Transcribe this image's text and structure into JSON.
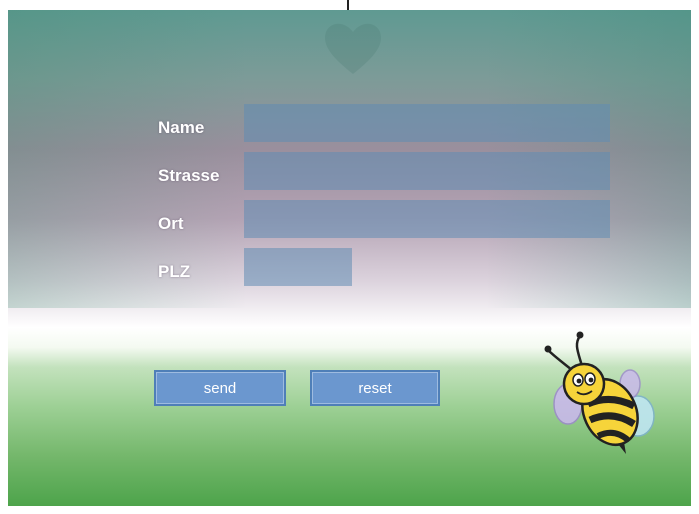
{
  "form": {
    "fields": [
      {
        "label": "Name",
        "value": "",
        "type": "text"
      },
      {
        "label": "Strasse",
        "value": "",
        "type": "text"
      },
      {
        "label": "Ort",
        "value": "",
        "type": "text"
      },
      {
        "label": "PLZ",
        "value": "",
        "type": "text"
      }
    ],
    "send_label": "send",
    "reset_label": "reset"
  },
  "icons": {
    "watermark": "heart-icon",
    "mascot": "bee-mascot"
  },
  "colors": {
    "button_fill": "#6b97cf",
    "input_fill": "#608cb2",
    "label_text": "#ffffff"
  }
}
